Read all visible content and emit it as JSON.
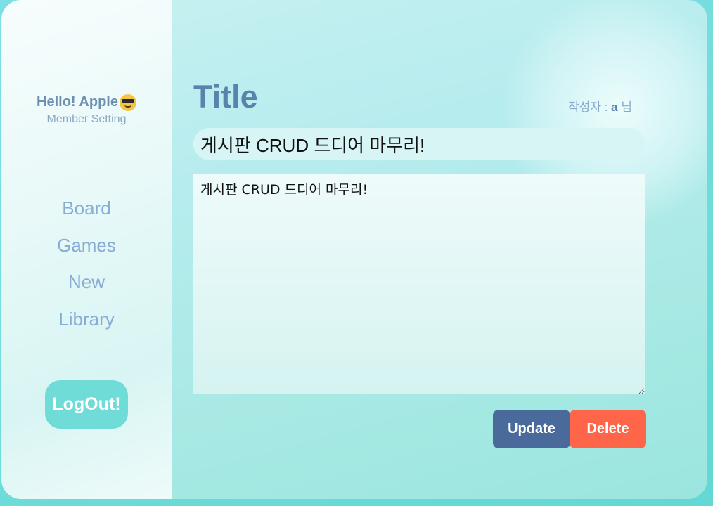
{
  "sidebar": {
    "greeting": "Hello! Apple",
    "greeting_emoji": "smiling-face-with-sunglasses-icon",
    "member_setting": "Member Setting",
    "nav": [
      {
        "label": "Board"
      },
      {
        "label": "Games"
      },
      {
        "label": "New"
      },
      {
        "label": "Library"
      }
    ],
    "logout_label": "LogOut!"
  },
  "post": {
    "heading": "Title",
    "author_prefix": "작성자 : ",
    "author_name": "a",
    "author_suffix": " 님",
    "title_value": "게시판 CRUD 드디어 마무리!",
    "content_value": "게시판 CRUD 드디어 마무리!"
  },
  "actions": {
    "update_label": "Update",
    "delete_label": "Delete"
  },
  "colors": {
    "accent": "#6fdcd8",
    "update": "#4b6a9c",
    "delete": "#ff6549",
    "nav_text": "#89acd4"
  }
}
